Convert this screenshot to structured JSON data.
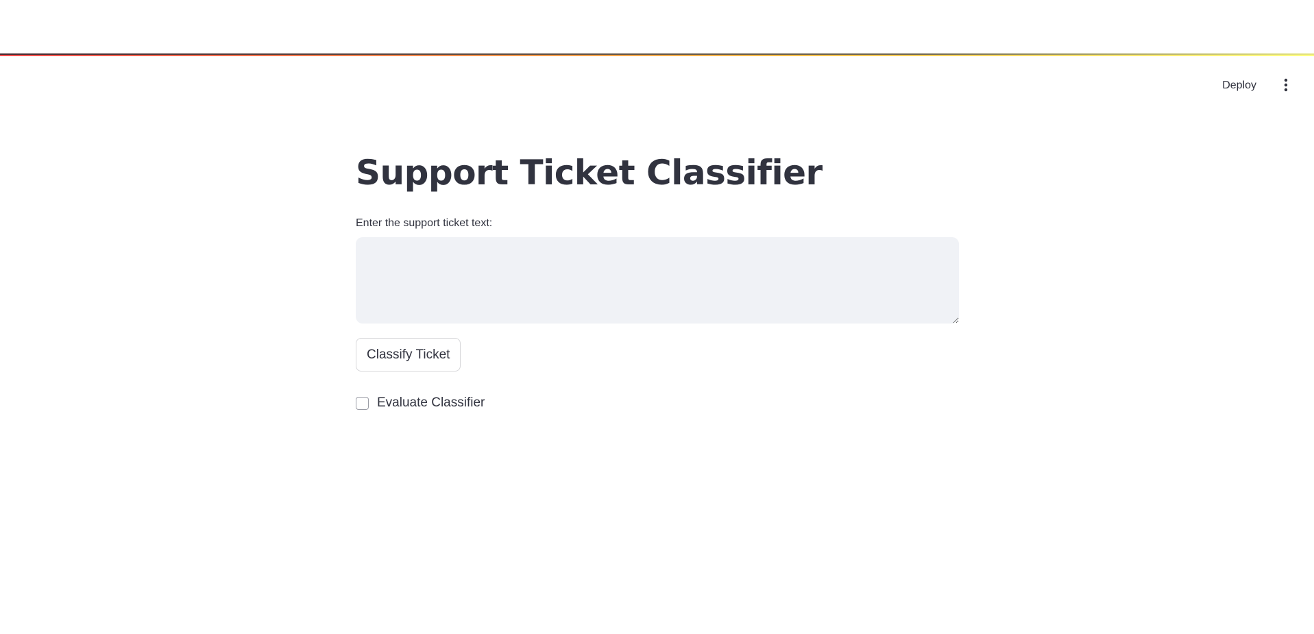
{
  "header": {
    "deploy_label": "Deploy",
    "menu_icon": "vertical-ellipsis-icon"
  },
  "main": {
    "title": "Support Ticket Classifier",
    "ticket_input": {
      "label": "Enter the support ticket text:",
      "value": "",
      "placeholder": ""
    },
    "classify_button_label": "Classify Ticket",
    "evaluate_checkbox": {
      "label": "Evaluate Classifier",
      "checked": false
    }
  },
  "colors": {
    "text": "#31333f",
    "input_background": "#f0f2f6",
    "accent_red": "#ff4b4b",
    "accent_yellow": "#fffd80"
  }
}
